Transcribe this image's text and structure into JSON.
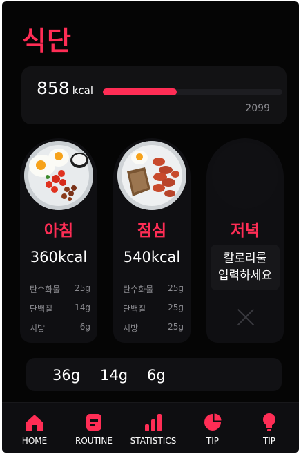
{
  "header": {
    "title": "식단"
  },
  "calories": {
    "consumed": "858",
    "unit": "kcal",
    "goal": "2099",
    "progress_fraction": 0.41
  },
  "meals": [
    {
      "name": "아침",
      "kcal": "360kcal",
      "nutrients": [
        {
          "label": "탄수화물",
          "value": "25g"
        },
        {
          "label": "단백질",
          "value": "14g"
        },
        {
          "label": "지방",
          "value": "6g"
        }
      ]
    },
    {
      "name": "점심",
      "kcal": "540kcal",
      "nutrients": [
        {
          "label": "탄수화물",
          "value": "25g"
        },
        {
          "label": "단백질",
          "value": "25g"
        },
        {
          "label": "지방",
          "value": "25g"
        }
      ]
    },
    {
      "name": "저녁",
      "prompt": "칼로리룰\n입력하세요"
    }
  ],
  "totals": {
    "carbs": "36g",
    "protein": "14g",
    "fat": "6g"
  },
  "nav": [
    {
      "label": "HOME",
      "icon": "home-icon"
    },
    {
      "label": "ROUTINE",
      "icon": "routine-icon"
    },
    {
      "label": "STATISTICS",
      "icon": "statistics-icon"
    },
    {
      "label": "TIP",
      "icon": "pie-chart-icon"
    },
    {
      "label": "TIP",
      "icon": "lightbulb-icon"
    }
  ],
  "colors": {
    "accent": "#ff2d55",
    "background": "#050505",
    "card": "#121214",
    "muted_text": "#8a8a8f"
  }
}
